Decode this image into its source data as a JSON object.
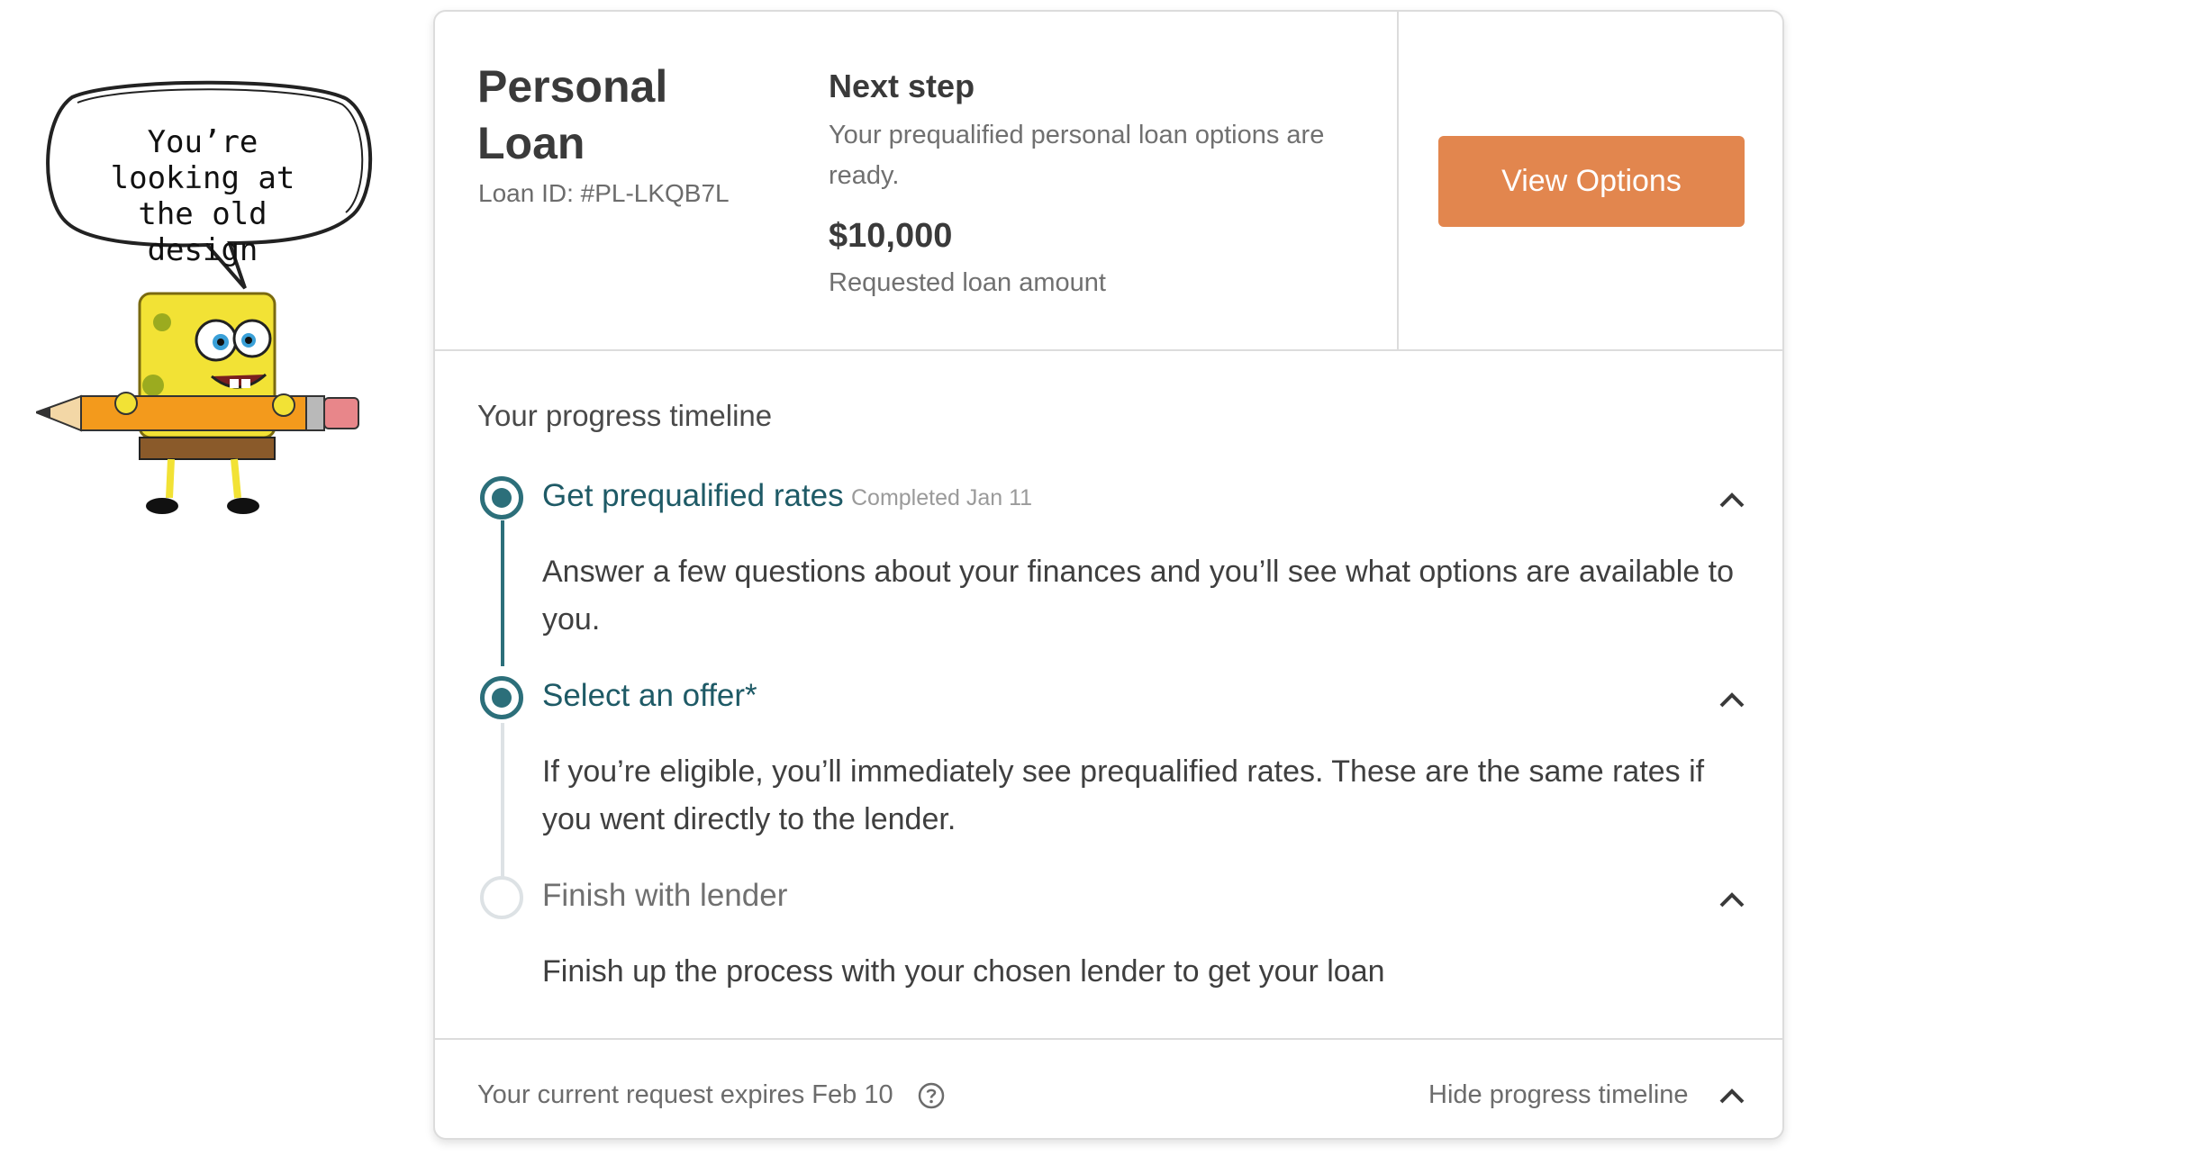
{
  "sticker": {
    "bubble_text": "You’re looking at the old design",
    "character_icon": "cartoon-sponge-holding-pencil"
  },
  "loan": {
    "title": "Personal Loan",
    "id_text": "Loan ID: #PL-LKQB7L"
  },
  "next_step": {
    "label": "Next step",
    "description": "Your prequalified personal loan options are ready.",
    "amount": "$10,000",
    "amount_label": "Requested loan amount"
  },
  "actions": {
    "view_options_label": "View Options"
  },
  "timeline": {
    "heading": "Your progress timeline",
    "steps": [
      {
        "title": "Get prequalified rates",
        "meta": "Completed Jan 11",
        "description": "Answer a few questions about your finances and you’ll see what options are available to you.",
        "status": "completed"
      },
      {
        "title": "Select an offer*",
        "meta": "",
        "description": "If you’re eligible, you’ll immediately see prequalified rates. These are the same rates if you went directly to the lender.",
        "status": "current"
      },
      {
        "title": "Finish with lender",
        "meta": "",
        "description": "Finish up the process with your chosen lender to get your loan",
        "status": "upcoming"
      }
    ]
  },
  "footer": {
    "expires_text": "Your current request expires Feb 10",
    "hide_label": "Hide progress timeline"
  },
  "colors": {
    "accent_teal": "#2c6f7a",
    "button_orange": "#e2864e",
    "border": "#dcdcdc"
  }
}
